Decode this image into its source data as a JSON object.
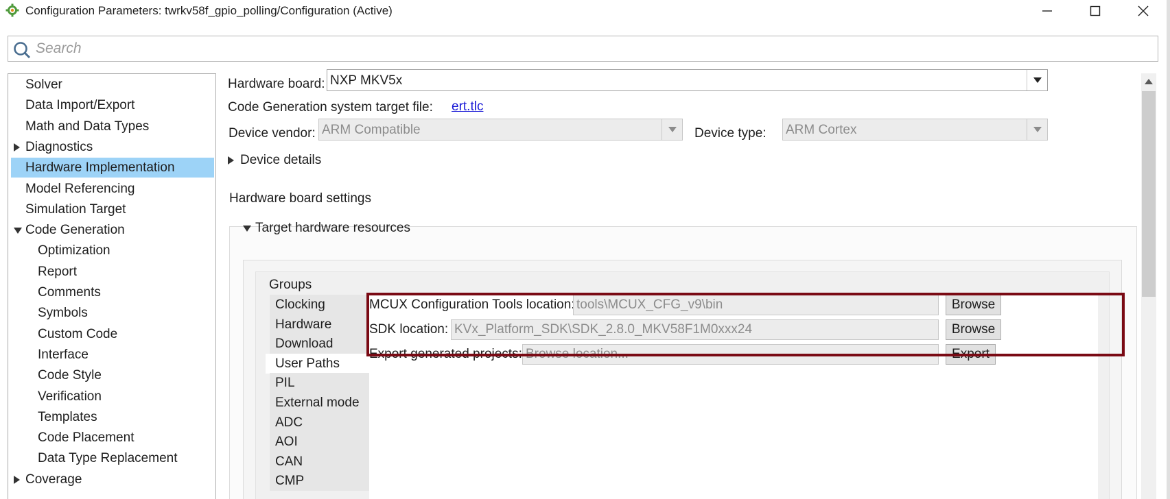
{
  "window": {
    "title": "Configuration Parameters: twrkv58f_gpio_polling/Configuration (Active)",
    "controls": [
      "minimize-icon",
      "maximize-icon",
      "close-icon"
    ]
  },
  "search": {
    "placeholder": "Search",
    "value": ""
  },
  "tree": {
    "items": [
      {
        "label": "Solver",
        "level": 0,
        "expander": "none",
        "selected": false
      },
      {
        "label": "Data Import/Export",
        "level": 0,
        "expander": "none",
        "selected": false
      },
      {
        "label": "Math and Data Types",
        "level": 0,
        "expander": "none",
        "selected": false
      },
      {
        "label": "Diagnostics",
        "level": 0,
        "expander": "collapsed",
        "selected": false
      },
      {
        "label": "Hardware Implementation",
        "level": 0,
        "expander": "none",
        "selected": true
      },
      {
        "label": "Model Referencing",
        "level": 0,
        "expander": "none",
        "selected": false
      },
      {
        "label": "Simulation Target",
        "level": 0,
        "expander": "none",
        "selected": false
      },
      {
        "label": "Code Generation",
        "level": 0,
        "expander": "expanded",
        "selected": false
      },
      {
        "label": "Optimization",
        "level": 1,
        "expander": "none",
        "selected": false
      },
      {
        "label": "Report",
        "level": 1,
        "expander": "none",
        "selected": false
      },
      {
        "label": "Comments",
        "level": 1,
        "expander": "none",
        "selected": false
      },
      {
        "label": "Symbols",
        "level": 1,
        "expander": "none",
        "selected": false
      },
      {
        "label": "Custom Code",
        "level": 1,
        "expander": "none",
        "selected": false
      },
      {
        "label": "Interface",
        "level": 1,
        "expander": "none",
        "selected": false
      },
      {
        "label": "Code Style",
        "level": 1,
        "expander": "none",
        "selected": false
      },
      {
        "label": "Verification",
        "level": 1,
        "expander": "none",
        "selected": false
      },
      {
        "label": "Templates",
        "level": 1,
        "expander": "none",
        "selected": false
      },
      {
        "label": "Code Placement",
        "level": 1,
        "expander": "none",
        "selected": false
      },
      {
        "label": "Data Type Replacement",
        "level": 1,
        "expander": "none",
        "selected": false
      },
      {
        "label": "Coverage",
        "level": 0,
        "expander": "collapsed",
        "selected": false
      }
    ]
  },
  "hardware": {
    "board_label": "Hardware board:",
    "board_value": "NXP MKV5x",
    "target_file_label": "Code Generation system target file:",
    "target_file_link": "ert.tlc",
    "vendor_label": "Device vendor:",
    "vendor_value": "ARM Compatible",
    "type_label": "Device type:",
    "type_value": "ARM Cortex",
    "device_details_label": "Device details",
    "board_settings_label": "Hardware board settings",
    "target_resources_label": "Target hardware resources",
    "groups_label": "Groups",
    "groups": [
      {
        "label": "Clocking",
        "selected": false
      },
      {
        "label": "Hardware",
        "selected": false
      },
      {
        "label": "Download",
        "selected": false
      },
      {
        "label": "User Paths",
        "selected": true
      },
      {
        "label": "PIL",
        "selected": false
      },
      {
        "label": "External mode",
        "selected": false
      },
      {
        "label": "ADC",
        "selected": false
      },
      {
        "label": "AOI",
        "selected": false
      },
      {
        "label": "CAN",
        "selected": false
      },
      {
        "label": "CMP",
        "selected": false
      }
    ],
    "user_paths": {
      "mcux_label": "MCUX Configuration Tools location:",
      "mcux_value": "tools\\MCUX_CFG_v9\\bin",
      "mcux_button": "Browse",
      "sdk_label": "SDK location:",
      "sdk_value": "KVx_Platform_SDK\\SDK_2.8.0_MKV58F1M0xxx24",
      "sdk_button": "Browse",
      "export_label": "Export generated projects:",
      "export_placeholder": "Browse location...",
      "export_button": "Export"
    }
  },
  "colors": {
    "selection": "#9dd3f7",
    "highlight_border": "#7a0a14",
    "link": "#1a1ad6"
  }
}
